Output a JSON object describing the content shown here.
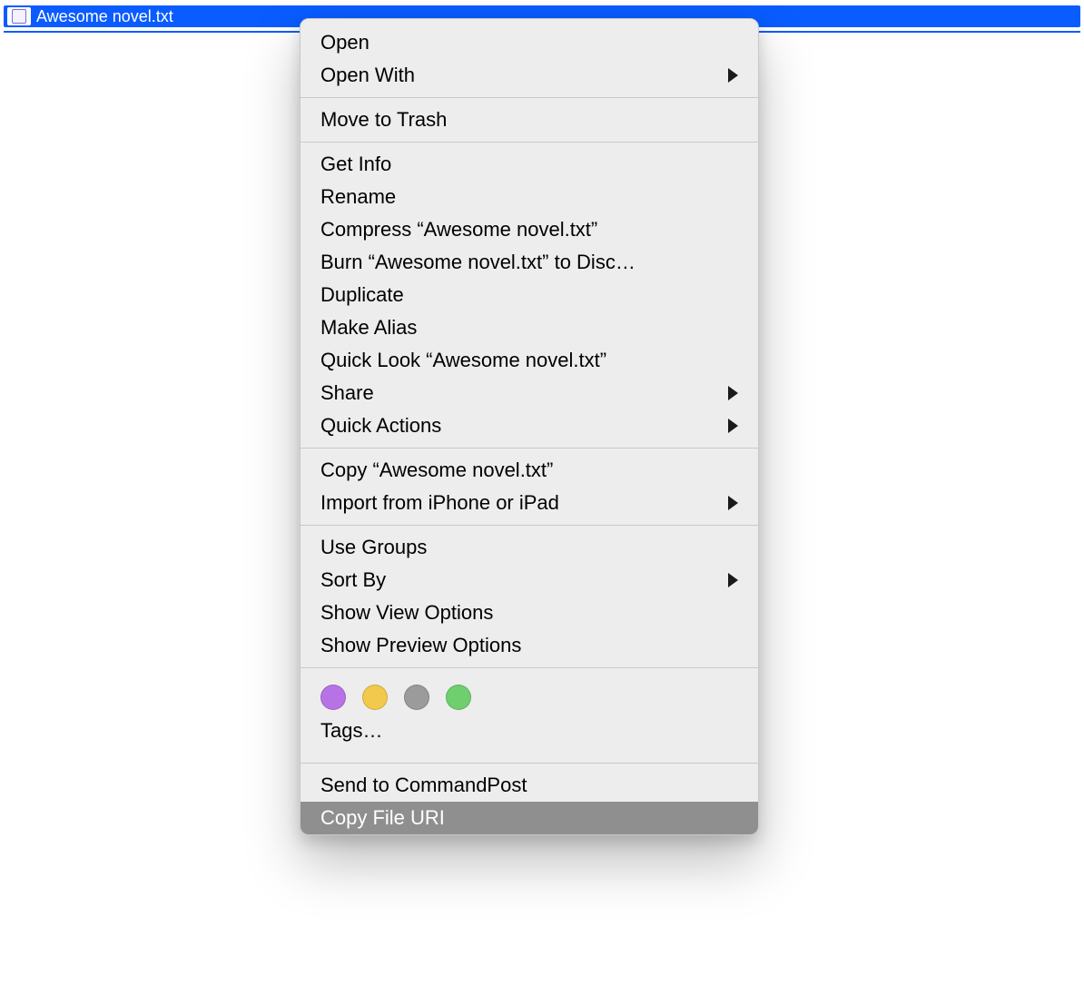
{
  "finder": {
    "selected_file": "Awesome novel.txt"
  },
  "context_menu": {
    "groups": [
      [
        {
          "label": "Open",
          "submenu": false
        },
        {
          "label": "Open With",
          "submenu": true
        }
      ],
      [
        {
          "label": "Move to Trash",
          "submenu": false
        }
      ],
      [
        {
          "label": "Get Info",
          "submenu": false
        },
        {
          "label": "Rename",
          "submenu": false
        },
        {
          "label": "Compress “Awesome novel.txt”",
          "submenu": false
        },
        {
          "label": "Burn “Awesome novel.txt” to Disc…",
          "submenu": false
        },
        {
          "label": "Duplicate",
          "submenu": false
        },
        {
          "label": "Make Alias",
          "submenu": false
        },
        {
          "label": "Quick Look “Awesome novel.txt”",
          "submenu": false
        },
        {
          "label": "Share",
          "submenu": true
        },
        {
          "label": "Quick Actions",
          "submenu": true
        }
      ],
      [
        {
          "label": "Copy “Awesome novel.txt”",
          "submenu": false
        },
        {
          "label": "Import from iPhone or iPad",
          "submenu": true
        }
      ],
      [
        {
          "label": "Use Groups",
          "submenu": false
        },
        {
          "label": "Sort By",
          "submenu": true
        },
        {
          "label": "Show View Options",
          "submenu": false
        },
        {
          "label": "Show Preview Options",
          "submenu": false
        }
      ]
    ],
    "tags": {
      "colors": [
        "purple",
        "yellow",
        "gray",
        "green"
      ],
      "label": "Tags…"
    },
    "services": [
      {
        "label": "Send to CommandPost",
        "highlighted": false
      },
      {
        "label": "Copy File URI",
        "highlighted": true
      }
    ]
  },
  "colors": {
    "selection": "#0a5cff",
    "menu_bg": "#ededed",
    "highlight": "#8f8f8f"
  }
}
